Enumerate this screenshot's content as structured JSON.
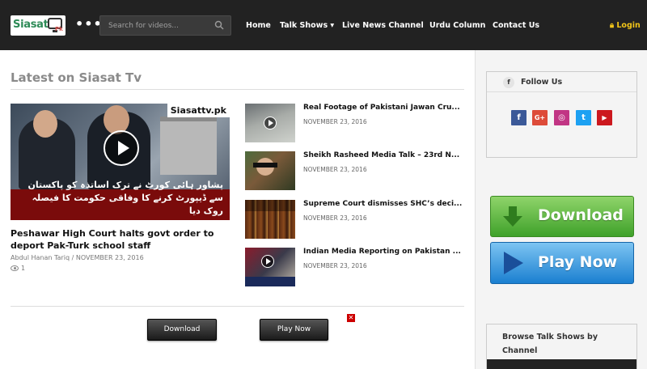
{
  "header": {
    "logo_text": "Siasat",
    "logo_suffix": "Pk",
    "menu_dots": "•••",
    "search_placeholder": "Search for videos...",
    "nav": [
      {
        "label": "Home"
      },
      {
        "label": "Talk Shows ▾"
      },
      {
        "label": "Live News Channel"
      },
      {
        "label": "Urdu Column"
      },
      {
        "label": "Contact Us"
      }
    ],
    "login_label": "Login"
  },
  "main": {
    "section_title": "Latest on Siasat Tv",
    "featured": {
      "thumb_watermark": "Siasattv.pk",
      "thumb_caption": "پشاور ہائی کورٹ نے ترک اساتذہ کو پاکستان سے ڈیپورٹ کرنے کا وفاقی حکومت کا فیصلہ روک دیا",
      "title": "Peshawar High Court halts govt order to deport Pak-Turk school staff",
      "author": "Abdul Hanan Tariq",
      "separator": "/",
      "date": "NOVEMBER 23, 2016",
      "views": "1"
    },
    "side_items": [
      {
        "title": "Real Footage of Pakistani Jawan Cru...",
        "date": "NOVEMBER 23, 2016"
      },
      {
        "title": "Sheikh Rasheed Media Talk – 23rd N...",
        "date": "NOVEMBER 23, 2016"
      },
      {
        "title": "Supreme Court dismisses SHC’s deci...",
        "date": "NOVEMBER 23, 2016"
      },
      {
        "title": "Indian Media Reporting on Pakistan ...",
        "date": "NOVEMBER 23, 2016"
      }
    ],
    "ad": {
      "download_label": "Download",
      "playnow_label": "Play Now",
      "close_label": "✕"
    }
  },
  "sidebar": {
    "follow_icon": "f",
    "follow_label": "Follow Us",
    "social": [
      {
        "icon": "facebook-icon",
        "glyph": "f",
        "color": "#3b5998"
      },
      {
        "icon": "google-plus-icon",
        "glyph": "G+",
        "color": "#dd4b39"
      },
      {
        "icon": "instagram-icon",
        "glyph": "◎",
        "color": "#c13584"
      },
      {
        "icon": "twitter-icon",
        "glyph": "t",
        "color": "#1da1f2"
      },
      {
        "icon": "youtube-icon",
        "glyph": "▶",
        "color": "#cc181e"
      }
    ],
    "download_label": "Download",
    "playnow_label": "Play Now",
    "browse_label": "Browse Talk Shows by Channel"
  },
  "colors": {
    "header_bg": "#222222",
    "login_accent": "#f0c419",
    "download_green": "#3fa12a",
    "playnow_blue": "#1a7fd0"
  }
}
